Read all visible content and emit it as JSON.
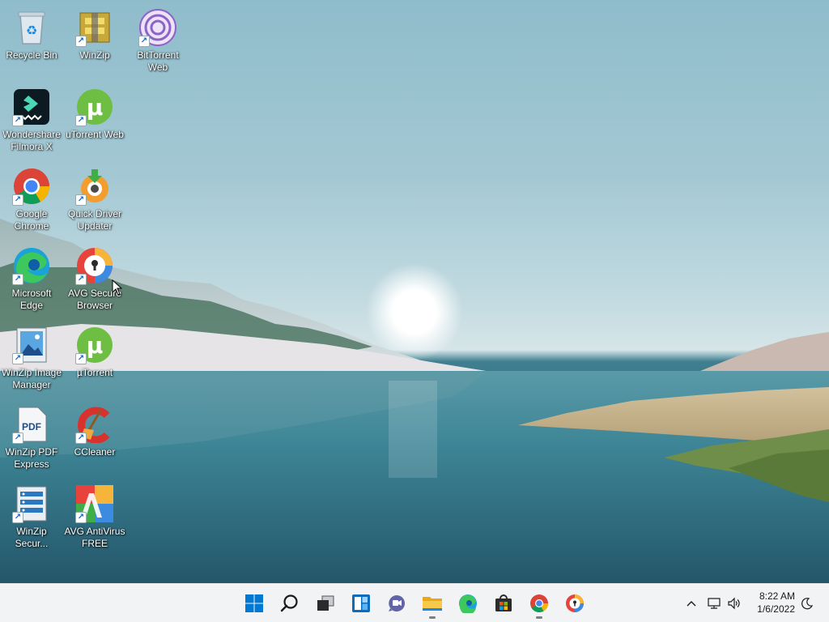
{
  "desktop": {
    "icons": [
      {
        "name": "recycle-bin-icon",
        "label": "Recycle Bin"
      },
      {
        "name": "winzip-icon",
        "label": "WinZip"
      },
      {
        "name": "bittorrent-web-icon",
        "label": "BitTorrent Web"
      },
      {
        "name": "filmora-icon",
        "label": "Wondershare Filmora X"
      },
      {
        "name": "utorrent-web-icon",
        "label": "uTorrent Web"
      },
      {
        "name": "chrome-icon",
        "label": "Google Chrome"
      },
      {
        "name": "quick-driver-updater-icon",
        "label": "Quick Driver Updater"
      },
      {
        "name": "edge-icon",
        "label": "Microsoft Edge"
      },
      {
        "name": "avg-secure-browser-icon",
        "label": "AVG Secure Browser"
      },
      {
        "name": "winzip-image-manager-icon",
        "label": "WinZip Image Manager"
      },
      {
        "name": "utorrent-icon",
        "label": "µTorrent"
      },
      {
        "name": "winzip-pdf-express-icon",
        "label": "WinZip PDF Express"
      },
      {
        "name": "ccleaner-icon",
        "label": "CCleaner"
      },
      {
        "name": "winzip-secure-icon",
        "label": "WinZip Secur..."
      },
      {
        "name": "avg-antivirus-icon",
        "label": "AVG AntiVirus FREE"
      }
    ]
  },
  "taskbar": {
    "apps": [
      {
        "name": "start-icon"
      },
      {
        "name": "search-icon"
      },
      {
        "name": "task-view-icon"
      },
      {
        "name": "widgets-icon"
      },
      {
        "name": "teams-chat-icon"
      },
      {
        "name": "file-explorer-icon",
        "running": true
      },
      {
        "name": "edge-taskbar-icon"
      },
      {
        "name": "store-icon"
      },
      {
        "name": "chrome-taskbar-icon",
        "running": true
      },
      {
        "name": "avg-browser-taskbar-icon"
      }
    ],
    "clock": {
      "time": "8:22 AM",
      "date": "1/6/2022"
    }
  },
  "colors": {
    "taskbar_bg": "#f1f3f5",
    "accent_blue": "#0078d4"
  }
}
